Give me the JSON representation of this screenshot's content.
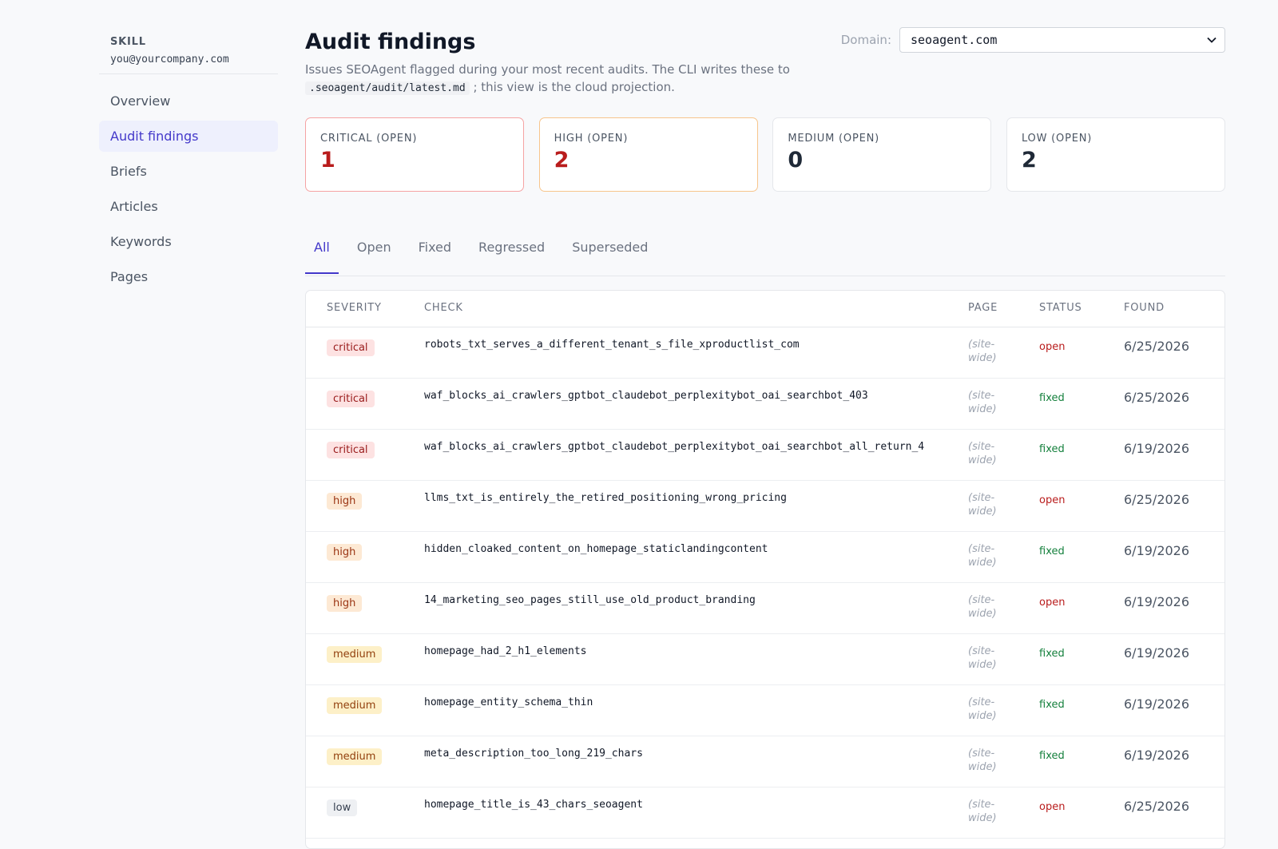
{
  "sidebar": {
    "brand": "SKILL",
    "email": "you@yourcompany.com",
    "items": [
      {
        "label": "Overview",
        "active": false
      },
      {
        "label": "Audit findings",
        "active": true
      },
      {
        "label": "Briefs",
        "active": false
      },
      {
        "label": "Articles",
        "active": false
      },
      {
        "label": "Keywords",
        "active": false
      },
      {
        "label": "Pages",
        "active": false
      }
    ]
  },
  "header": {
    "title": "Audit findings",
    "domain_label": "Domain:",
    "domain_value": "seoagent.com",
    "desc_before": "Issues SEOAgent flagged during your most recent audits. The CLI writes these to",
    "desc_code": ".seoagent/audit/latest.md",
    "desc_after": "; this view is the cloud projection."
  },
  "cards": [
    {
      "label": "CRITICAL (OPEN)",
      "value": "1"
    },
    {
      "label": "HIGH (OPEN)",
      "value": "2"
    },
    {
      "label": "MEDIUM (OPEN)",
      "value": "0"
    },
    {
      "label": "LOW (OPEN)",
      "value": "2"
    }
  ],
  "tabs": [
    "All",
    "Open",
    "Fixed",
    "Regressed",
    "Superseded"
  ],
  "active_tab": "All",
  "table": {
    "headers": {
      "severity": "SEVERITY",
      "check": "CHECK",
      "page": "PAGE",
      "status": "STATUS",
      "found": "FOUND"
    },
    "rows": [
      {
        "severity": "critical",
        "check": "robots_txt_serves_a_different_tenant_s_file_xproductlist_com",
        "page": "(site-wide)",
        "status": "open",
        "found": "6/25/2026"
      },
      {
        "severity": "critical",
        "check": "waf_blocks_ai_crawlers_gptbot_claudebot_perplexitybot_oai_searchbot_403",
        "page": "(site-wide)",
        "status": "fixed",
        "found": "6/25/2026"
      },
      {
        "severity": "critical",
        "check": "waf_blocks_ai_crawlers_gptbot_claudebot_perplexitybot_oai_searchbot_all_return_4",
        "page": "(site-wide)",
        "status": "fixed",
        "found": "6/19/2026"
      },
      {
        "severity": "high",
        "check": "llms_txt_is_entirely_the_retired_positioning_wrong_pricing",
        "page": "(site-wide)",
        "status": "open",
        "found": "6/25/2026"
      },
      {
        "severity": "high",
        "check": "hidden_cloaked_content_on_homepage_staticlandingcontent",
        "page": "(site-wide)",
        "status": "fixed",
        "found": "6/19/2026"
      },
      {
        "severity": "high",
        "check": "14_marketing_seo_pages_still_use_old_product_branding",
        "page": "(site-wide)",
        "status": "open",
        "found": "6/19/2026"
      },
      {
        "severity": "medium",
        "check": "homepage_had_2_h1_elements",
        "page": "(site-wide)",
        "status": "fixed",
        "found": "6/19/2026"
      },
      {
        "severity": "medium",
        "check": "homepage_entity_schema_thin",
        "page": "(site-wide)",
        "status": "fixed",
        "found": "6/19/2026"
      },
      {
        "severity": "medium",
        "check": "meta_description_too_long_219_chars",
        "page": "(site-wide)",
        "status": "fixed",
        "found": "6/19/2026"
      },
      {
        "severity": "low",
        "check": "homepage_title_is_43_chars_seoagent",
        "page": "(site-wide)",
        "status": "open",
        "found": "6/25/2026"
      }
    ]
  },
  "colors": {
    "accent": "#4338ca",
    "critical_border": "#f5a3a3",
    "high_border": "#f7c58c",
    "status_open": "#b91c1c",
    "status_fixed": "#15803d"
  }
}
